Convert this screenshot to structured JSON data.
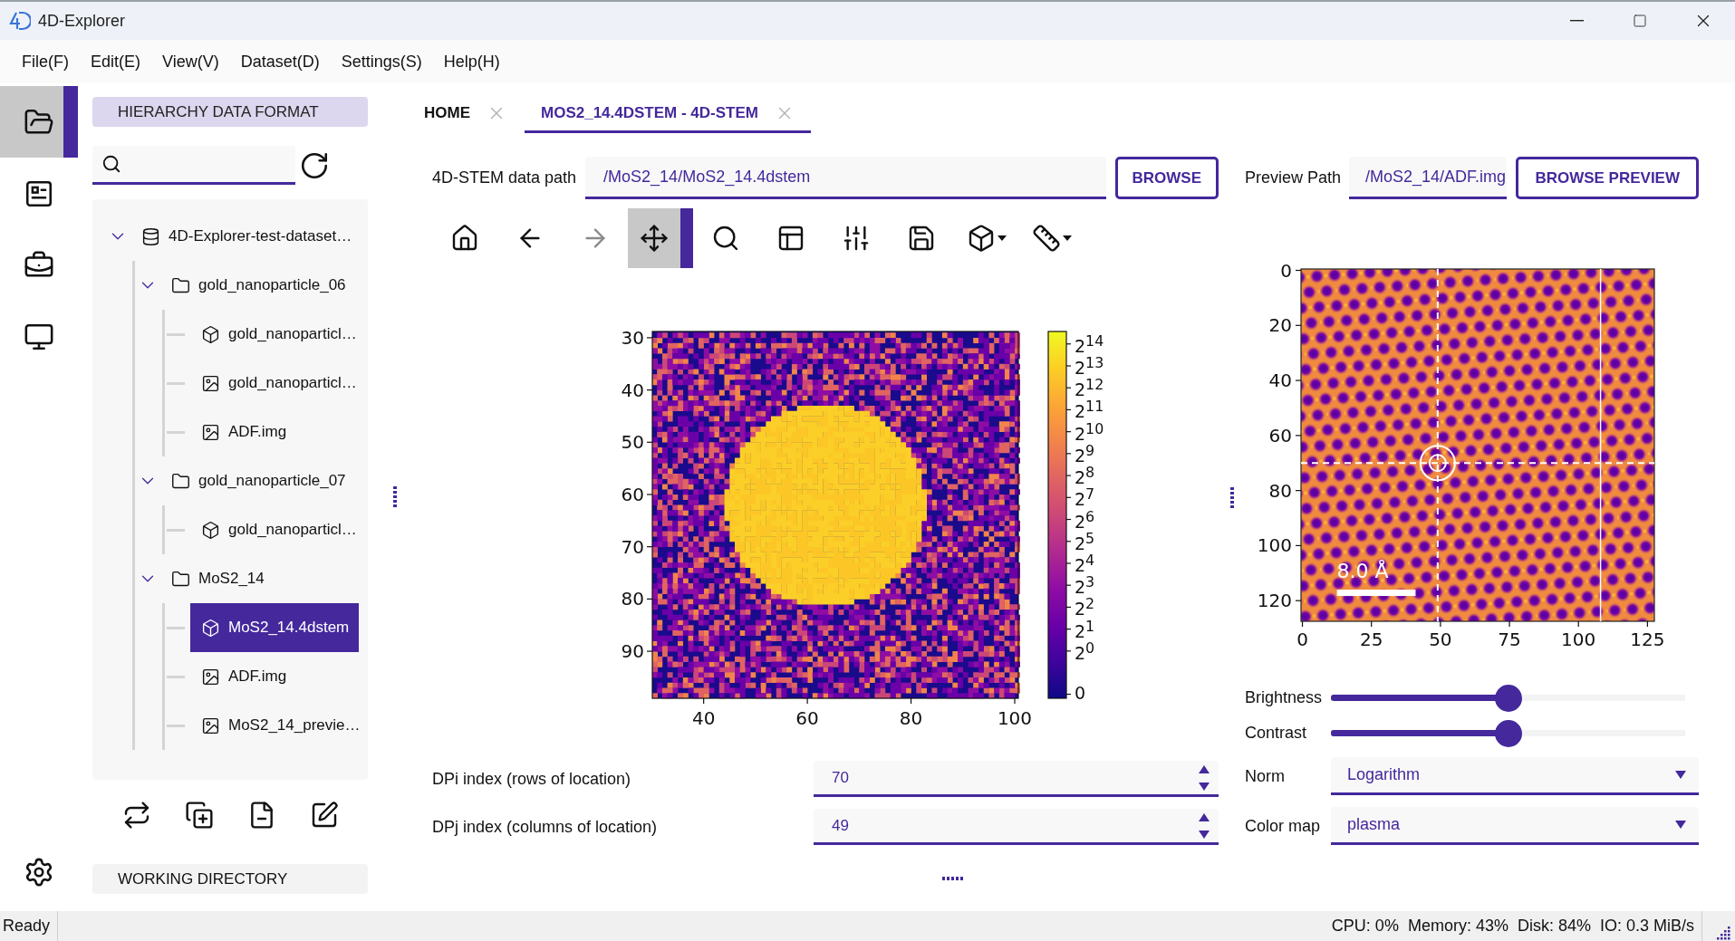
{
  "window": {
    "title": "4D-Explorer"
  },
  "menu": [
    "File(F)",
    "Edit(E)",
    "View(V)",
    "Dataset(D)",
    "Settings(S)",
    "Help(H)"
  ],
  "activity_bar": [
    {
      "kind": "folder",
      "selected": true
    },
    {
      "kind": "form",
      "selected": false
    },
    {
      "kind": "toolbox",
      "selected": false
    },
    {
      "kind": "monitor",
      "selected": false
    }
  ],
  "sidebar": {
    "header": "HIERARCHY DATA FORMAT",
    "tree": [
      {
        "label": "4D-Explorer-test-dataset…",
        "kind": "database",
        "expanded": true,
        "selected": false,
        "children": [
          {
            "label": "gold_nanoparticle_06",
            "kind": "folder",
            "expanded": true,
            "selected": false,
            "children": [
              {
                "label": "gold_nanoparticl…",
                "kind": "dataset",
                "selected": false
              },
              {
                "label": "gold_nanoparticl…",
                "kind": "image",
                "selected": false
              },
              {
                "label": "ADF.img",
                "kind": "image",
                "selected": false
              }
            ]
          },
          {
            "label": "gold_nanoparticle_07",
            "kind": "folder",
            "expanded": true,
            "selected": false,
            "children": [
              {
                "label": "gold_nanoparticl…",
                "kind": "dataset",
                "selected": false
              }
            ]
          },
          {
            "label": "MoS2_14",
            "kind": "folder",
            "expanded": true,
            "selected": false,
            "children": [
              {
                "label": "MoS2_14.4dstem",
                "kind": "dataset",
                "selected": true
              },
              {
                "label": "ADF.img",
                "kind": "image",
                "selected": false
              },
              {
                "label": "MoS2_14_previe…",
                "kind": "image",
                "selected": false
              }
            ]
          }
        ]
      }
    ],
    "footer": "WORKING DIRECTORY"
  },
  "tabs": [
    {
      "label": "HOME",
      "selected": false
    },
    {
      "label": "MOS2_14.4DSTEM - 4D-STEM",
      "selected": true
    }
  ],
  "data_path": {
    "label": "4D-STEM data path",
    "value": "/MoS2_14/MoS2_14.4dstem",
    "button": "BROWSE"
  },
  "toolbar": [
    {
      "kind": "home",
      "selected": false,
      "disabled": false,
      "dropdown": false
    },
    {
      "kind": "back",
      "selected": false,
      "disabled": false,
      "dropdown": false
    },
    {
      "kind": "forward",
      "selected": false,
      "disabled": true,
      "dropdown": false
    },
    {
      "kind": "pan",
      "selected": true,
      "disabled": false,
      "dropdown": false
    },
    {
      "kind": "zoom",
      "selected": false,
      "disabled": false,
      "dropdown": false
    },
    {
      "kind": "layout",
      "selected": false,
      "disabled": false,
      "dropdown": false
    },
    {
      "kind": "adjust",
      "selected": false,
      "disabled": false,
      "dropdown": false
    },
    {
      "kind": "save",
      "selected": false,
      "disabled": false,
      "dropdown": false
    },
    {
      "kind": "cube",
      "selected": false,
      "disabled": false,
      "dropdown": true
    },
    {
      "kind": "ruler",
      "selected": false,
      "disabled": false,
      "dropdown": true
    }
  ],
  "diffraction_plot": {
    "y_ticks": [
      "30",
      "40",
      "50",
      "60",
      "70",
      "80",
      "90"
    ],
    "x_ticks": [
      "40",
      "60",
      "80",
      "100"
    ],
    "colorbar_ticks": [
      "2$^{14}$",
      "2$^{13}$",
      "2$^{12}$",
      "2$^{11}$",
      "2$^{10}$",
      "2$^{9}$",
      "2$^{8}$",
      "2$^{7}$",
      "2$^{6}$",
      "2$^{5}$",
      "2$^{4}$",
      "2$^{3}$",
      "2$^{2}$",
      "2$^{1}$",
      "2$^{0}$",
      "0"
    ]
  },
  "dp_index": [
    {
      "label": "DPi index (rows of location)",
      "value": "70"
    },
    {
      "label": "DPj index (columns of location)",
      "value": "49"
    }
  ],
  "preview_path": {
    "label": "Preview Path",
    "value": "/MoS2_14/ADF.img",
    "button": "BROWSE PREVIEW"
  },
  "preview_plot": {
    "y_ticks": [
      "0",
      "20",
      "40",
      "60",
      "80",
      "100",
      "120"
    ],
    "x_ticks": [
      "0",
      "25",
      "50",
      "75",
      "100",
      "125"
    ],
    "scale_bar": "8.0 Å"
  },
  "sliders": [
    {
      "label": "Brightness",
      "level": 0.5
    },
    {
      "label": "Contrast",
      "level": 0.5
    }
  ],
  "selects": [
    {
      "label": "Norm",
      "value": "Logarithm"
    },
    {
      "label": "Color map",
      "value": "plasma"
    }
  ],
  "status_bar": {
    "message": "Ready",
    "stats": [
      "CPU: 0%",
      "Memory: 43%",
      "Disk: 84%",
      "IO: 0.3 MiB/s"
    ]
  }
}
